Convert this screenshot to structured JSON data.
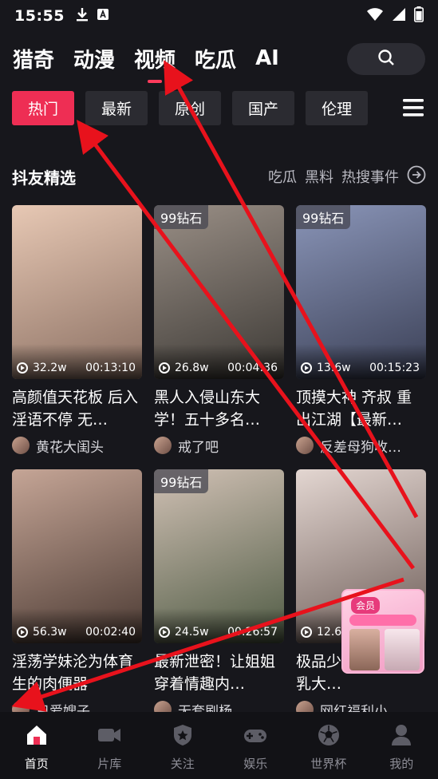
{
  "status_bar": {
    "time": "15:55"
  },
  "top_nav": {
    "tabs": [
      {
        "label": "猎奇"
      },
      {
        "label": "动漫"
      },
      {
        "label": "视频"
      },
      {
        "label": "吃瓜"
      },
      {
        "label": "AI"
      }
    ],
    "active_index": 2
  },
  "categories": {
    "items": [
      "热门",
      "最新",
      "原创",
      "国产",
      "伦理"
    ],
    "active_index": 0
  },
  "section": {
    "title": "抖友精选",
    "links": [
      "吃瓜",
      "黑料",
      "热搜事件"
    ]
  },
  "cards": [
    {
      "badge": "",
      "views": "32.2w",
      "duration": "00:13:10",
      "title": "高颜值天花板 后入淫语不停 无…",
      "author": "黄花大闺头",
      "colors": [
        "#e7c8b4",
        "#8a6f62"
      ]
    },
    {
      "badge": "99钻石",
      "views": "26.8w",
      "duration": "00:04:36",
      "title": "黑人入侵山东大学！五十多名…",
      "author": "戒了吧",
      "colors": [
        "#9a8f86",
        "#3c3935"
      ]
    },
    {
      "badge": "99钻石",
      "views": "13.6w",
      "duration": "00:15:23",
      "title": "顶摸大神 齐叔 重出江湖【最新…",
      "author": "反差母狗收…",
      "colors": [
        "#8a95b8",
        "#3a3f55"
      ]
    },
    {
      "badge": "",
      "views": "56.3w",
      "duration": "00:02:40",
      "title": "淫荡学妹沦为体育生的肉便器",
      "author": "只爱嫂子",
      "colors": [
        "#c5a596",
        "#4b3a33"
      ]
    },
    {
      "badge": "99钻石",
      "views": "24.5w",
      "duration": "00:26:57",
      "title": "最新泄密！让姐姐穿着情趣内…",
      "author": "无套刷杨",
      "colors": [
        "#d1c1b5",
        "#4e5a43"
      ]
    },
    {
      "badge": "",
      "views": "12.6w",
      "duration": "",
      "title": "极品少妇 神性感巨乳大…",
      "author": "网红福利小…",
      "colors": [
        "#e3d6d1",
        "#6b5a55"
      ]
    }
  ],
  "float_ad": {
    "tag": "会员"
  },
  "bottom_nav": {
    "items": [
      {
        "label": "首页",
        "icon": "home-icon"
      },
      {
        "label": "片库",
        "icon": "video-camera-icon"
      },
      {
        "label": "关注",
        "icon": "star-badge-icon"
      },
      {
        "label": "娱乐",
        "icon": "gamepad-icon"
      },
      {
        "label": "世界杯",
        "icon": "soccer-ball-icon"
      },
      {
        "label": "我的",
        "icon": "user-icon"
      }
    ],
    "active_index": 0
  },
  "colors": {
    "accent": "#ee2e54",
    "background": "#17171c",
    "annotation_red": "#e8121c"
  }
}
